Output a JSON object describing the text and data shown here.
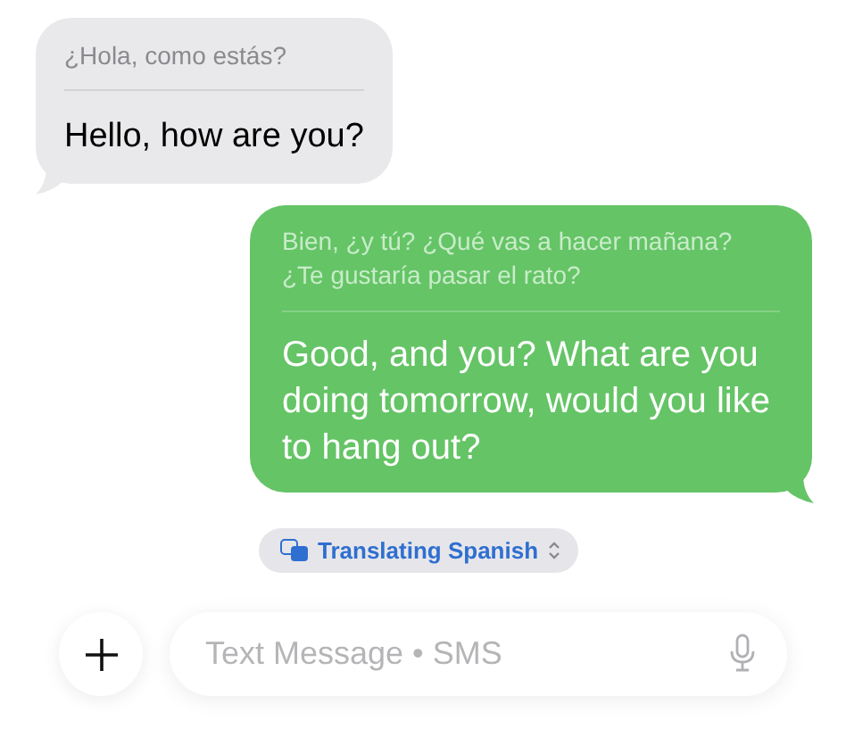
{
  "messages": [
    {
      "kind": "incoming",
      "original": "¿Hola, como estás?",
      "translation": "Hello, how are you?"
    },
    {
      "kind": "outgoing",
      "original": "Bien, ¿y tú? ¿Qué vas a hacer mañana? ¿Te gustaría pasar el rato?",
      "translation": "Good, and you? What are you doing tomorrow, would you like to hang out?"
    }
  ],
  "translation_pill": {
    "label": "Translating Spanish"
  },
  "composer": {
    "placeholder": "Text Message • SMS"
  }
}
